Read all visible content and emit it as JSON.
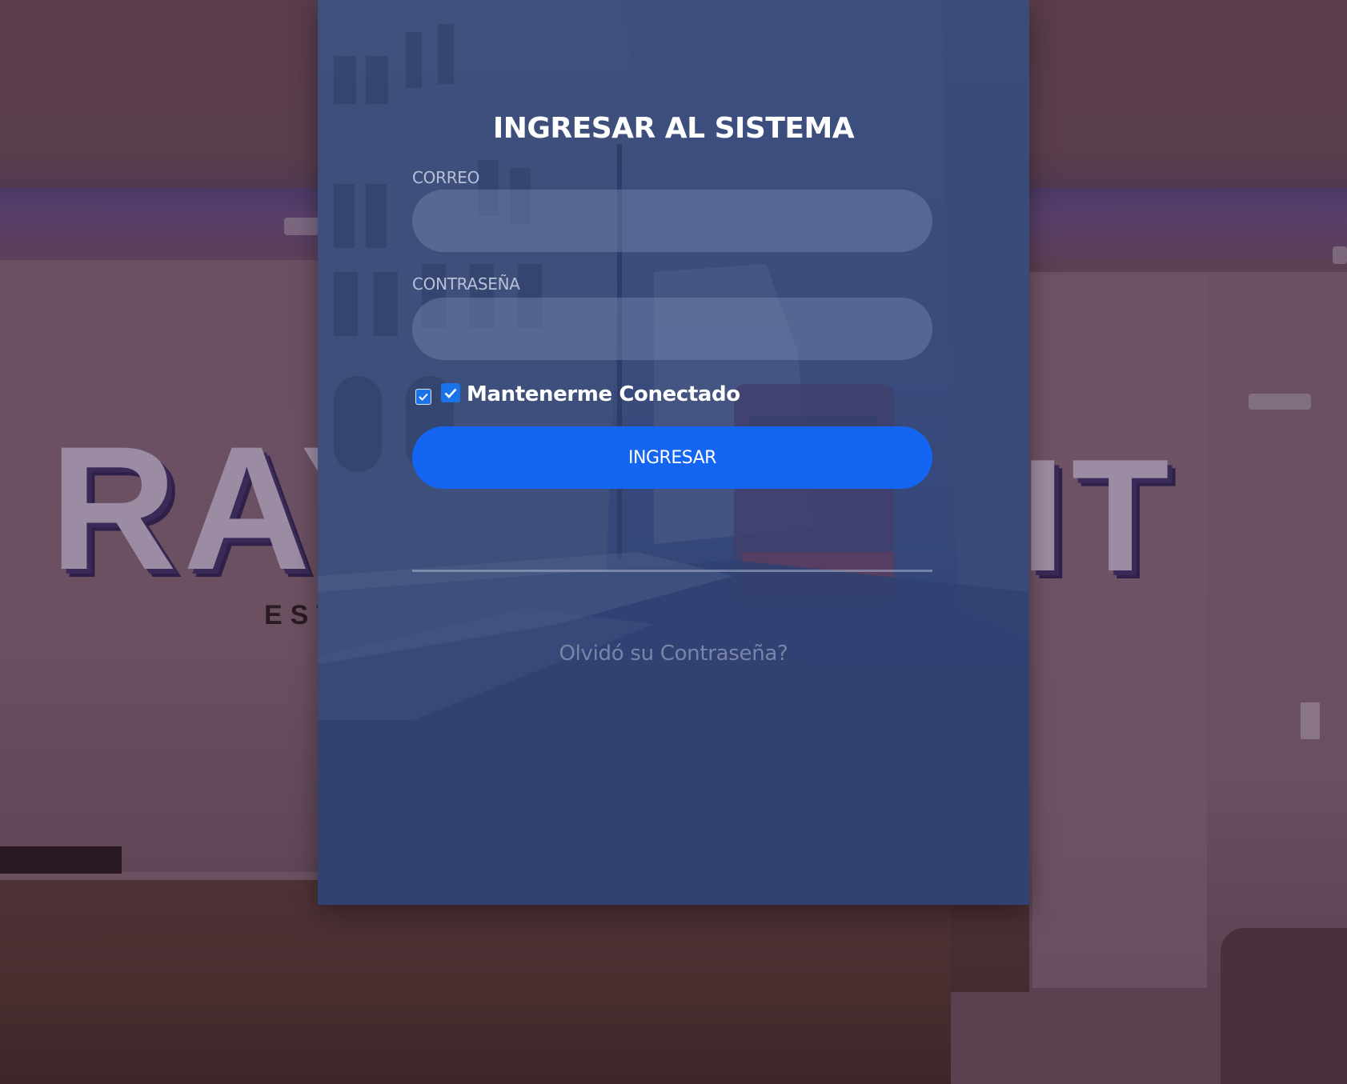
{
  "background": {
    "sign_letters_left": "RAY",
    "sign_letters_right": "IT",
    "sign_subtext": "EST"
  },
  "login": {
    "title": "INGRESAR AL SISTEMA",
    "email_label": "CORREO",
    "email_value": "",
    "password_label": "CONTRASEÑA",
    "password_value": "",
    "remember_label": "Mantenerme Conectado",
    "remember_checked": true,
    "submit_label": "INGRESAR",
    "forgot_label": "Olvidó su Contraseña?"
  },
  "colors": {
    "panel": "#3a4c7c",
    "button": "#1565f3",
    "checkbox": "#1a73e8"
  },
  "icons": {
    "checkbox": "checkmark-icon"
  }
}
